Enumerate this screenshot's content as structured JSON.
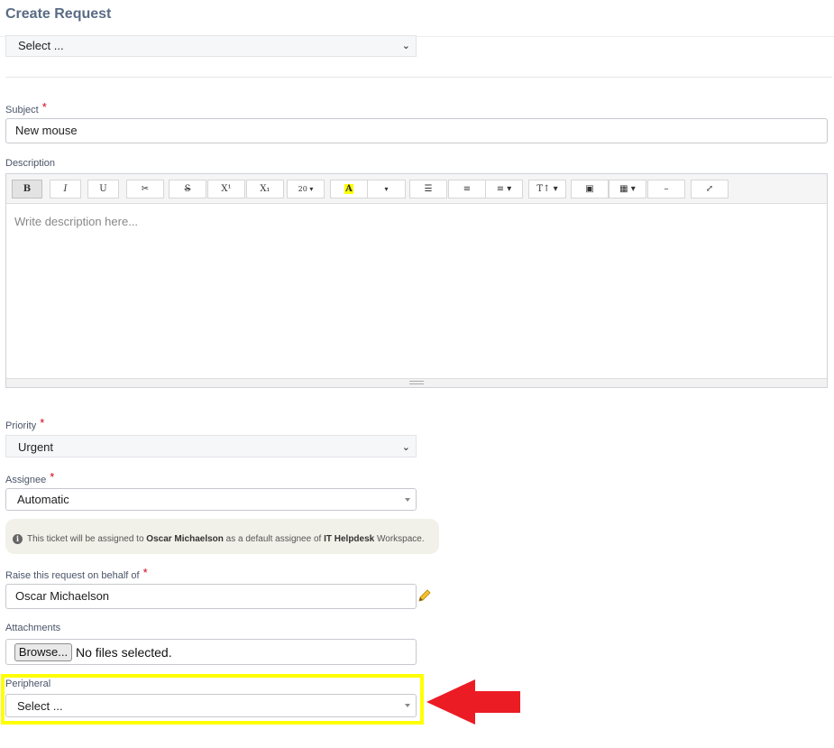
{
  "page": {
    "title": "Create Request"
  },
  "top_select": {
    "value": "Select ..."
  },
  "subject": {
    "label": "Subject",
    "required": "*",
    "value": "New mouse"
  },
  "description": {
    "label": "Description",
    "placeholder": "Write description here...",
    "toolbar": {
      "bold": "B",
      "italic": "I",
      "underline": "U",
      "eraser": "✂",
      "strike": "S",
      "superscript": "X¹",
      "subscript": "X₁",
      "font_size": "20 ▾",
      "highlight": "A",
      "color_dropdown": "▾",
      "bullet_list": "☰",
      "numbered_list": "≡",
      "align": "≡ ▾",
      "text_style": "T↑ ▾",
      "image": "▣",
      "table": "▦ ▾",
      "hr": "–",
      "fullscreen": "⤢"
    }
  },
  "priority": {
    "label": "Priority",
    "required": "*",
    "value": "Urgent"
  },
  "assignee": {
    "label": "Assignee",
    "required": "*",
    "value": "Automatic"
  },
  "info": {
    "prefix": "This ticket will be assigned to",
    "person": "Oscar Michaelson",
    "middle": "as a default assignee of",
    "workspace": "IT Helpdesk",
    "suffix": "Workspace."
  },
  "behalf": {
    "label": "Raise this request on behalf of",
    "required": "*",
    "value": "Oscar Michaelson"
  },
  "attachments": {
    "label": "Attachments",
    "browse_label": "Browse...",
    "status": "No files selected."
  },
  "peripheral": {
    "label": "Peripheral",
    "value": "Select ..."
  },
  "colors": {
    "highlight": "#ffff00",
    "arrow": "#ec1c24",
    "required": "#d0021b",
    "title": "#5a6b85"
  },
  "icons": {
    "info": "info-icon",
    "pencil": "pencil-icon",
    "arrow": "arrow-left-icon"
  }
}
